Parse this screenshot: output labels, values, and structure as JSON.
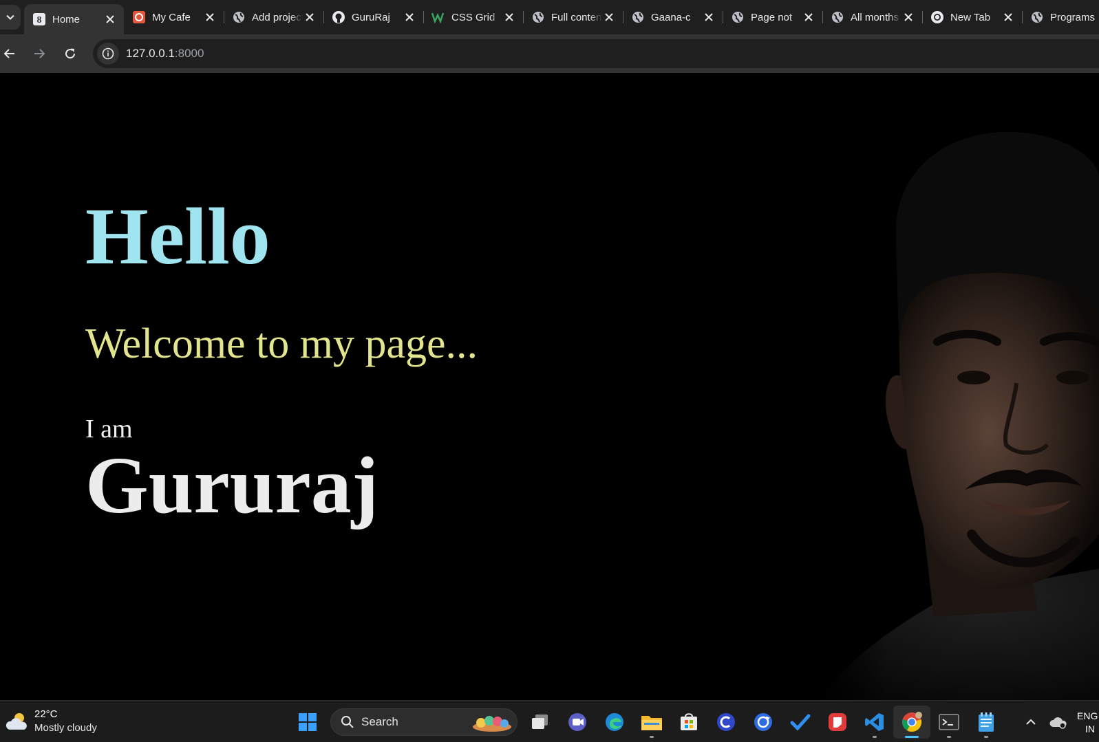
{
  "browser": {
    "tabs": [
      {
        "title": "Home",
        "favicon": "google-g-icon",
        "active": true
      },
      {
        "title": "My Cafe",
        "favicon": "cafe-app-icon",
        "active": false
      },
      {
        "title": "Add project",
        "favicon": "globe-icon",
        "active": false
      },
      {
        "title": "GuruRaj",
        "favicon": "github-icon",
        "active": false
      },
      {
        "title": "CSS Grid",
        "favicon": "w3schools-icon",
        "active": false
      },
      {
        "title": "Full content",
        "favicon": "globe-icon",
        "active": false
      },
      {
        "title": "Gaana-c",
        "favicon": "globe-icon",
        "active": false
      },
      {
        "title": "Page not",
        "favicon": "globe-icon",
        "active": false
      },
      {
        "title": "All months",
        "favicon": "globe-icon",
        "active": false
      },
      {
        "title": "New Tab",
        "favicon": "chrome-icon",
        "active": false
      },
      {
        "title": "Programs",
        "favicon": "globe-icon",
        "active": false
      }
    ],
    "url_host": "127.0.0.1",
    "url_port": ":8000"
  },
  "page": {
    "greeting": "Hello",
    "welcome": "Welcome to my page...",
    "intro": "I am",
    "name": "Gururaj"
  },
  "colors": {
    "greeting": "#9fe4ee",
    "welcome": "#e3e58e",
    "name": "#ececec",
    "page_bg": "#000000"
  },
  "taskbar": {
    "weather_temp": "22°C",
    "weather_condition": "Mostly cloudy",
    "search_label": "Search",
    "lang_line1": "ENG",
    "lang_line2": "IN",
    "pinned": [
      "start-icon",
      "search",
      "task-view-icon",
      "teams-icon",
      "edge-icon",
      "file-explorer-icon",
      "store-icon",
      "app-icon",
      "app-icon",
      "todo-icon",
      "app-icon",
      "vscode-icon",
      "chrome-icon",
      "terminal-icon",
      "notepad-icon"
    ]
  }
}
